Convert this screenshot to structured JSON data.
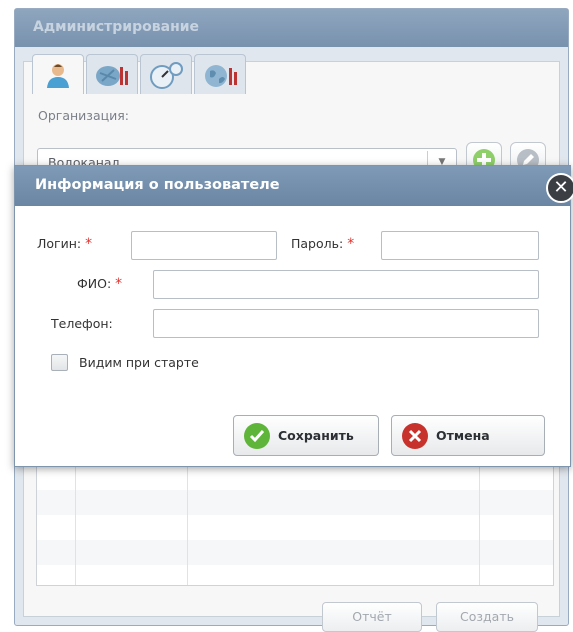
{
  "admin": {
    "title": "Администрирование",
    "tabs": [
      {
        "icon": "user-icon"
      },
      {
        "icon": "network-icon"
      },
      {
        "icon": "gauge-icon"
      },
      {
        "icon": "globe-icon"
      }
    ],
    "org_label": "Организация:",
    "org_value": "Водоканал",
    "add_icon": "plus-icon",
    "edit_icon": "pencil-icon",
    "report_button": "Отчёт",
    "create_button": "Создать"
  },
  "dialog": {
    "title": "Информация о пользователе",
    "login_label": "Логин:",
    "password_label": "Пароль:",
    "fio_label": "ФИО:",
    "phone_label": "Телефон:",
    "required_mark": "*",
    "login_value": "",
    "password_value": "",
    "fio_value": "",
    "phone_value": "",
    "visible_label": "Видим при старте",
    "visible_checked": false,
    "save_button": "Сохранить",
    "cancel_button": "Отмена"
  },
  "colors": {
    "header": "#7891ad",
    "save_accent": "#5fb53a",
    "cancel_accent": "#c8322c",
    "required": "#e0322e"
  }
}
